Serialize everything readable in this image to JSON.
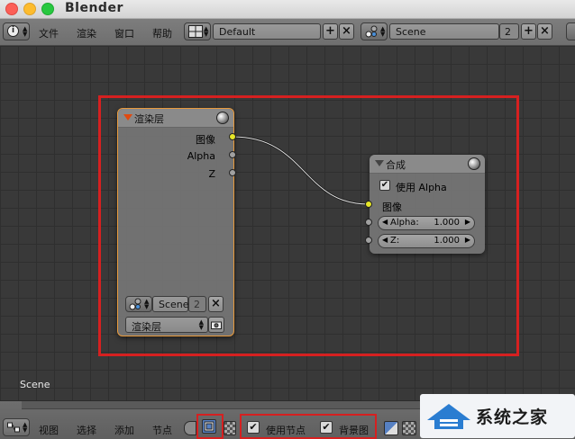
{
  "window": {
    "title": "Blender"
  },
  "top_header": {
    "menus": [
      "文件",
      "渲染",
      "窗口",
      "帮助"
    ],
    "screen_layout": "Default",
    "scene_name": "Scene",
    "scene_users": "2"
  },
  "nodes": {
    "render_layers": {
      "title": "渲染层",
      "outputs": [
        "图像",
        "Alpha",
        "Z"
      ],
      "scene_field": "Scene",
      "scene_users": "2",
      "layer_dropdown": "渲染层"
    },
    "composite": {
      "title": "合成",
      "use_alpha_label": "使用 Alpha",
      "use_alpha_checked": true,
      "image_input": "图像",
      "alpha_label": "Alpha:",
      "alpha_value": "1.000",
      "z_label": "Z:",
      "z_value": "1.000"
    }
  },
  "editor": {
    "scene_label": "Scene"
  },
  "bottom_header": {
    "menus": [
      "视图",
      "选择",
      "添加",
      "节点"
    ],
    "use_nodes_label": "使用节点",
    "use_nodes_checked": true,
    "backdrop_label": "背景图",
    "backdrop_checked": true
  },
  "watermark": {
    "text": "系统之家"
  },
  "colors": {
    "highlight_red": "#d62020",
    "socket_yellow": "#e6e628",
    "editor_bg": "#393939"
  }
}
